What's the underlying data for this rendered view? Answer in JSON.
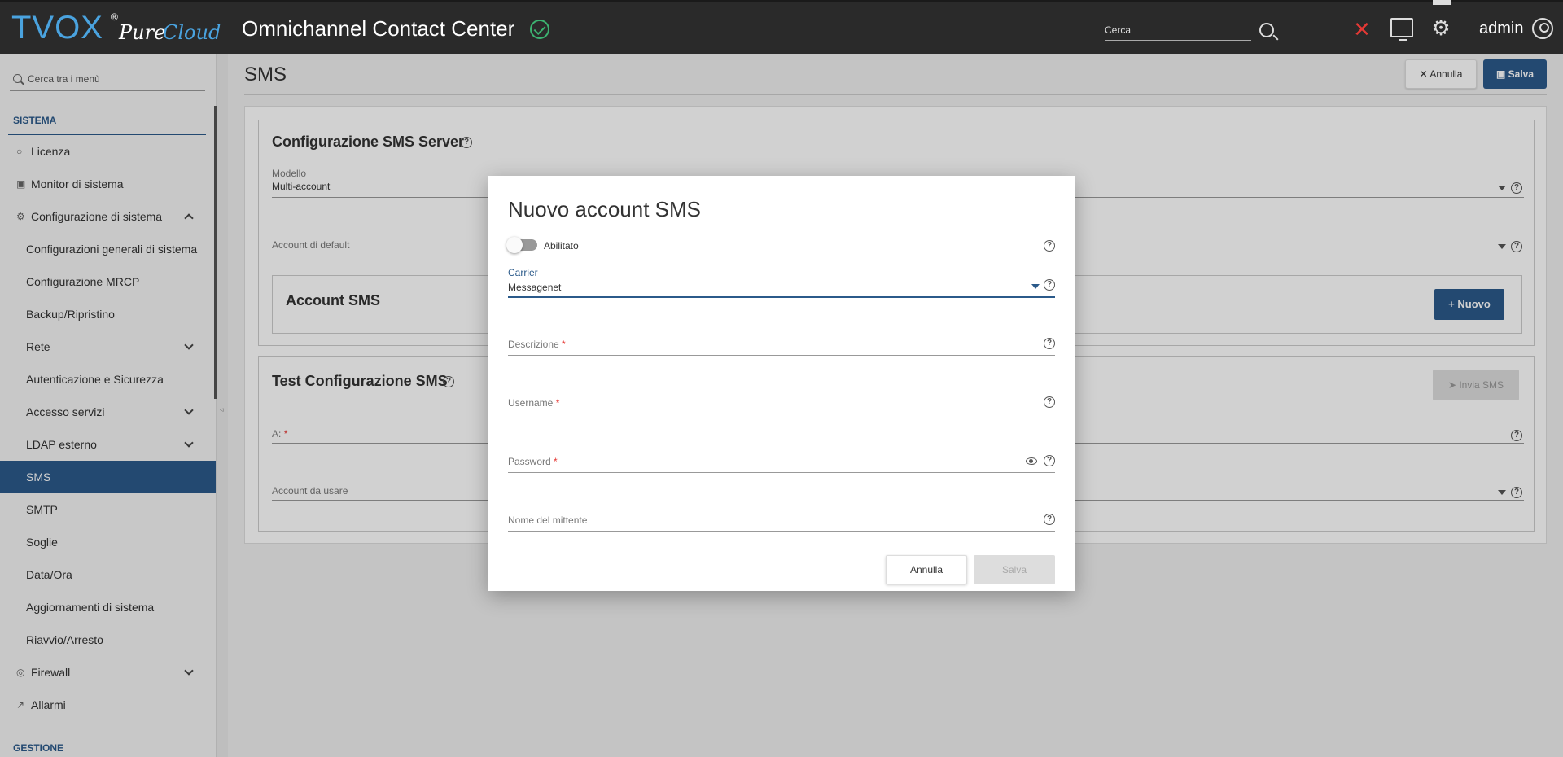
{
  "header": {
    "logo_text": "TVOX",
    "logo_registered": "®",
    "logo_pure": "Pure",
    "logo_cloud": "Cloud",
    "app_title": "Omnichannel Contact Center",
    "search_placeholder": "Cerca",
    "user_name": "admin",
    "icons": [
      "status-ok-icon",
      "search-icon",
      "tools-icon",
      "monitor-icon",
      "gear-icon",
      "user-icon"
    ],
    "alert_color": "#e53935"
  },
  "sidebar": {
    "search_placeholder": "Cerca tra i menù",
    "section_title": "SISTEMA",
    "section_title_2": "GESTIONE",
    "items": [
      {
        "label": "Licenza",
        "icon": "license-icon"
      },
      {
        "label": "Monitor di sistema",
        "icon": "monitor-icon"
      },
      {
        "label": "Configurazione di sistema",
        "icon": "config-icon",
        "expanded": true
      },
      {
        "label": "Configurazioni generali di sistema"
      },
      {
        "label": "Configurazione MRCP"
      },
      {
        "label": "Backup/Ripristino"
      },
      {
        "label": "Rete",
        "expandable": true
      },
      {
        "label": "Autenticazione e Sicurezza"
      },
      {
        "label": "Accesso servizi",
        "expandable": true
      },
      {
        "label": "LDAP esterno",
        "expandable": true
      },
      {
        "label": "SMS",
        "active": true
      },
      {
        "label": "SMTP"
      },
      {
        "label": "Soglie"
      },
      {
        "label": "Data/Ora"
      },
      {
        "label": "Aggiornamenti di sistema"
      },
      {
        "label": "Riavvio/Arresto"
      },
      {
        "label": "Firewall",
        "icon": "firewall-icon",
        "expandable": true
      },
      {
        "label": "Allarmi",
        "icon": "alarm-icon"
      }
    ]
  },
  "main": {
    "page_title": "SMS",
    "annulla_label": "Annulla",
    "salva_label": "Salva",
    "server_config": {
      "title": "Configurazione SMS Server",
      "modello_label": "Modello",
      "modello_value": "Multi-account",
      "account_default_label": "Account di default"
    },
    "account_sms": {
      "title": "Account SMS",
      "nuovo_label": "Nuovo"
    },
    "test_config": {
      "title": "Test Configurazione SMS",
      "invia_label": "Invia SMS",
      "to_label": "A:",
      "account_label": "Account da usare"
    }
  },
  "modal": {
    "title": "Nuovo account SMS",
    "toggle_label": "Abilitato",
    "toggle_on": false,
    "carrier_label": "Carrier",
    "carrier_value": "Messagenet",
    "descrizione_label": "Descrizione",
    "username_label": "Username",
    "password_label": "Password",
    "mittente_label": "Nome del mittente",
    "required_mark": "*",
    "annulla_label": "Annulla",
    "salva_label": "Salva",
    "accent_color": "#2b5a8a"
  }
}
